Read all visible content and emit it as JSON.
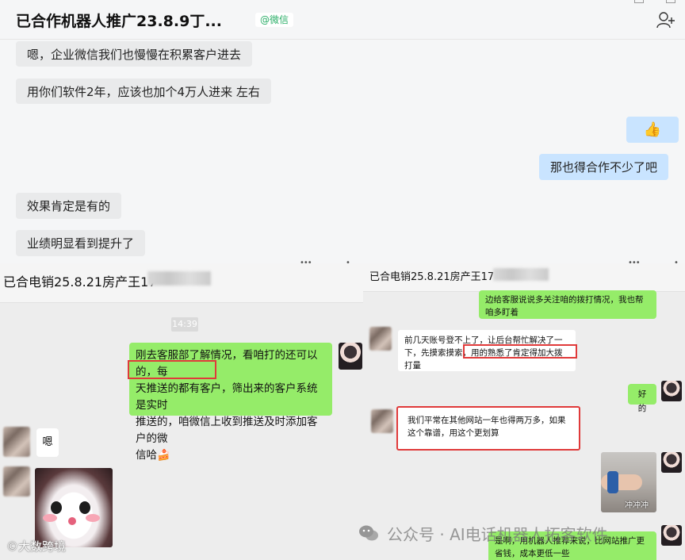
{
  "top": {
    "title": "已合作机器人推广23.8.9丁...",
    "title_tag": "@微信",
    "messages": [
      {
        "side": "left",
        "text": "嗯，企业微信我们也慢慢在积累客户进去"
      },
      {
        "side": "left",
        "text": "用你们软件2年，应该也加个4万人进来  左右"
      },
      {
        "side": "right",
        "text": "👍"
      },
      {
        "side": "right",
        "text": "那也得合作不少了吧"
      },
      {
        "side": "left",
        "text": "效果肯定是有的"
      },
      {
        "side": "left",
        "text": "业绩明显看到提升了"
      }
    ]
  },
  "bottom_left": {
    "title": "已合电销25.8.21房产王17",
    "time": "14:39",
    "msg1_line1": "刚去客服部了解情况，看咱打的还可以的，每",
    "msg1_line2_highlight": "天推送的都有客户，",
    "msg1_line2_rest": "筛出来的客户系统是实时",
    "msg1_line3": "推送的，咱微信上收到推送及时添加客户的微",
    "msg1_line4": "信哈🍰",
    "msg2": "嗯",
    "watermark": "©大数跨境"
  },
  "bottom_right": {
    "title": "已合电销25.8.21房产王17",
    "msg_top": "边给客服说说多关注咱的拨打情况，我也帮咱多盯着",
    "msg1_part1": "前几天账号登不上了，让后台帮忙解决了一下，先摸索摸索，",
    "msg1_highlight": "用的熟悉了肯定得加大拨打",
    "msg1_part2": "量",
    "msg2": "好的",
    "msg3": "我们平常在其他网站一年也得两万多，如果这个靠谱，用这个更划算",
    "photo_label": "冲冲冲",
    "msg4": "是啊，用机器人推荐来说，比网站推广更省钱，成本更低一些",
    "watermark": "公众号 · AI电话机器人拓客软件"
  }
}
